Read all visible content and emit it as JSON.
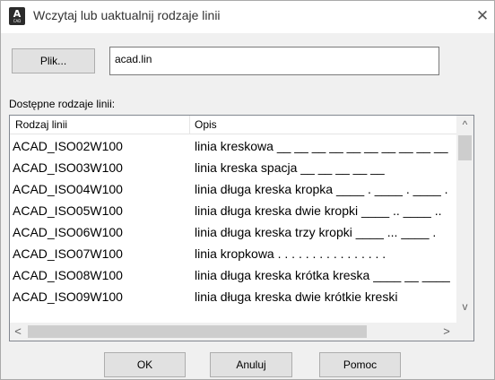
{
  "window": {
    "title": "Wczytaj lub uaktualnij rodzaje linii",
    "app_icon_letter": "A",
    "app_icon_sub": "CAD",
    "close_glyph": "✕"
  },
  "file": {
    "button_label": "Plik...",
    "value": "acad.lin"
  },
  "list": {
    "label": "Dostępne rodzaje linii:",
    "columns": [
      "Rodzaj linii",
      "Opis"
    ],
    "rows": [
      {
        "name": "ACAD_ISO02W100",
        "desc": "linia kreskowa __ __ __ __ __ __ __ __ __ __"
      },
      {
        "name": "ACAD_ISO03W100",
        "desc": "linia kreska spacja __     __     __     __     __"
      },
      {
        "name": "ACAD_ISO04W100",
        "desc": "linia długa kreska kropka ____ . ____ . ____ ."
      },
      {
        "name": "ACAD_ISO05W100",
        "desc": "linia długa kreska dwie kropki ____ .. ____ .."
      },
      {
        "name": "ACAD_ISO06W100",
        "desc": "linia długa kreska trzy kropki ____ ... ____ ."
      },
      {
        "name": "ACAD_ISO07W100",
        "desc": "linia kropkowa . . . . . . . . . . . . . . . ."
      },
      {
        "name": "ACAD_ISO08W100",
        "desc": "linia długa kreska krótka kreska ____ __ ____"
      },
      {
        "name": "ACAD_ISO09W100",
        "desc": "linia długa kreska dwie krótkie kreski"
      }
    ]
  },
  "buttons": {
    "ok": "OK",
    "cancel": "Anuluj",
    "help": "Pomoc"
  },
  "scroll_glyphs": {
    "up": "^",
    "down": "v",
    "left": "<",
    "right": ">"
  }
}
